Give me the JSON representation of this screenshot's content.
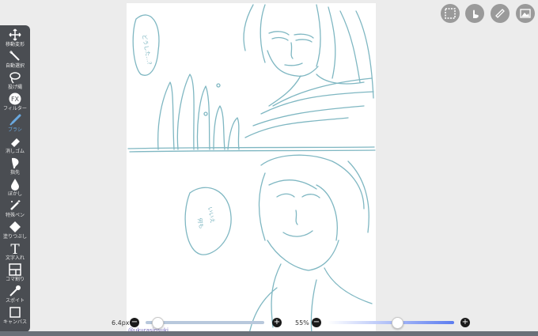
{
  "tools": [
    {
      "label": "移動変形",
      "icon": "move-icon"
    },
    {
      "label": "自動選択",
      "icon": "magic-wand-icon"
    },
    {
      "label": "投げ縄",
      "icon": "lasso-icon"
    },
    {
      "label": "フィルター",
      "icon": "fx-icon"
    },
    {
      "label": "ブラシ",
      "icon": "brush-icon"
    },
    {
      "label": "消しゴム",
      "icon": "eraser-icon"
    },
    {
      "label": "指先",
      "icon": "finger-icon"
    },
    {
      "label": "ぼかし",
      "icon": "blur-icon"
    },
    {
      "label": "特殊ペン",
      "icon": "special-pen-icon"
    },
    {
      "label": "塗りつぶし",
      "icon": "fill-icon"
    },
    {
      "label": "文字入れ",
      "icon": "text-icon"
    },
    {
      "label": "コマ割り",
      "icon": "frame-divider-icon"
    },
    {
      "label": "スポイト",
      "icon": "eyedropper-icon"
    },
    {
      "label": "キャンバス",
      "icon": "canvas-icon"
    }
  ],
  "fx_glyph": "FX",
  "text_glyph": "T",
  "active_tool": "ブラシ",
  "top_buttons": [
    "selection-icon",
    "touch-icon",
    "ruler-icon",
    "material-icon"
  ],
  "brush_size": {
    "label": "6.4px",
    "minus": "−",
    "plus": "+",
    "value": 6.4
  },
  "opacity": {
    "label": "55%",
    "minus": "−",
    "plus": "+",
    "value": 55
  },
  "watermark": "@ukurasinsuki",
  "colors": {
    "accent": "#6aa9e0",
    "sketch": "#7fb7c2",
    "toolbar": "#4a4d52"
  }
}
